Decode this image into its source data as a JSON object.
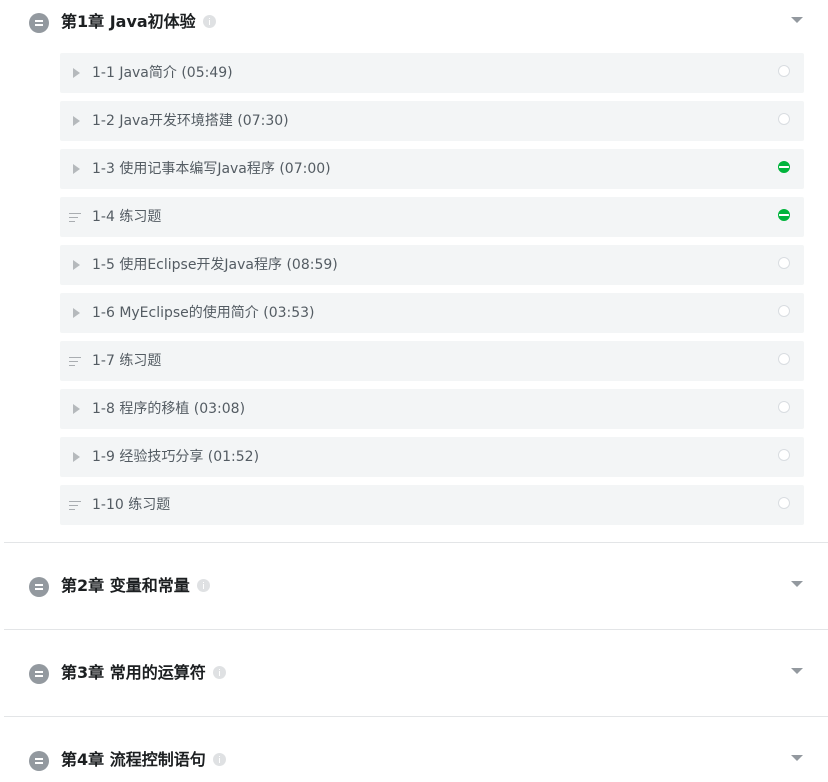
{
  "chapters": [
    {
      "title": "第1章 Java初体验",
      "expanded": true,
      "lessons": [
        {
          "label": "1-1 Java简介 (05:49)",
          "type": "video",
          "status": "not-started"
        },
        {
          "label": "1-2 Java开发环境搭建 (07:30)",
          "type": "video",
          "status": "not-started"
        },
        {
          "label": "1-3 使用记事本编写Java程序 (07:00)",
          "type": "video",
          "status": "in-progress"
        },
        {
          "label": "1-4 练习题",
          "type": "exercise",
          "status": "in-progress"
        },
        {
          "label": "1-5 使用Eclipse开发Java程序 (08:59)",
          "type": "video",
          "status": "not-started"
        },
        {
          "label": "1-6 MyEclipse的使用简介 (03:53)",
          "type": "video",
          "status": "not-started"
        },
        {
          "label": "1-7 练习题",
          "type": "exercise",
          "status": "not-started"
        },
        {
          "label": "1-8 程序的移植 (03:08)",
          "type": "video",
          "status": "not-started"
        },
        {
          "label": "1-9 经验技巧分享 (01:52)",
          "type": "video",
          "status": "not-started"
        },
        {
          "label": "1-10 练习题",
          "type": "exercise",
          "status": "not-started"
        }
      ]
    },
    {
      "title": "第2章 变量和常量",
      "expanded": false
    },
    {
      "title": "第3章 常用的运算符",
      "expanded": false
    },
    {
      "title": "第4章 流程控制语句",
      "expanded": false
    }
  ],
  "icons": {
    "chapter": "chapter-list-icon",
    "info": "info-icon",
    "toggle": "chevron-down-icon",
    "video": "play-icon",
    "exercise": "exercise-list-icon",
    "status": "progress-circle-icon"
  },
  "colors": {
    "progress": "#00b43c",
    "lesson_bg": "#f3f5f6",
    "chapter_icon": "#93999f"
  }
}
